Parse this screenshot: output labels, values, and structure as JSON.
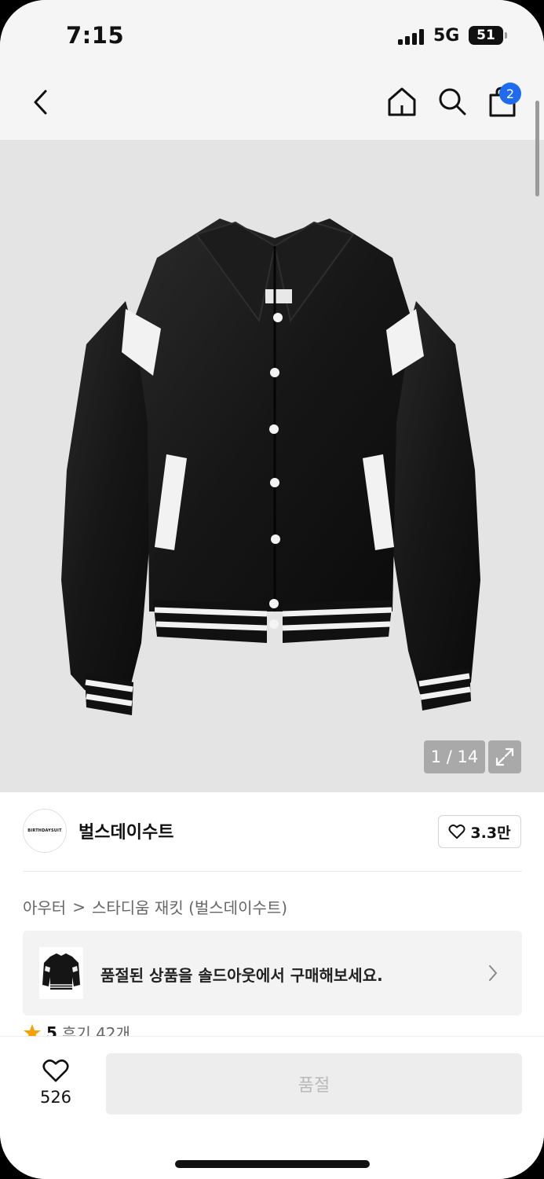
{
  "status_bar": {
    "time": "7:15",
    "network": "5G",
    "battery": "51"
  },
  "nav": {
    "cart_count": "2"
  },
  "image": {
    "counter": "1 / 14"
  },
  "brand": {
    "logo_text": "BIRTHDAYSUIT",
    "name": "벌스데이수트",
    "likes": "3.3만"
  },
  "breadcrumb": {
    "category": "아우터",
    "separator": ">",
    "product": "스타디움 재킷 (벌스데이수트)"
  },
  "soldout_banner": {
    "text": "품절된 상품을 솔드아웃에서 구매해보세요."
  },
  "review": {
    "score": "5",
    "label": "후기 42개"
  },
  "bottom_bar": {
    "wish_count": "526",
    "buy_label": "품절"
  },
  "colors": {
    "accent": "#1e6bf0",
    "star": "#f5a100",
    "disabled_button": "#ededed"
  }
}
